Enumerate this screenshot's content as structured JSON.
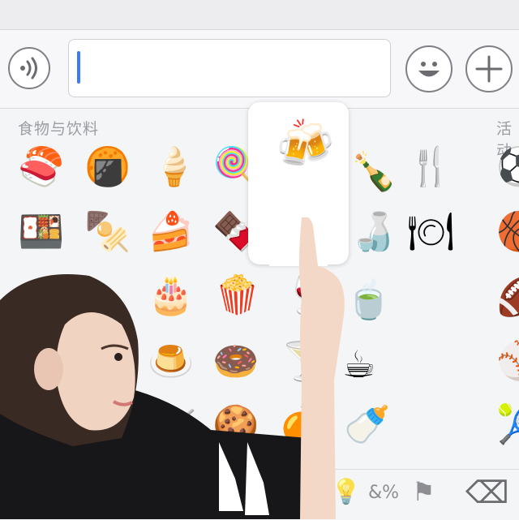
{
  "section_labels": {
    "food": "食物与饮料",
    "activity": "活动"
  },
  "popup_emoji": "🍻",
  "food_emojis": [
    "🍣",
    "🍘",
    "🍦",
    "🍭",
    "🍾",
    "🍴",
    "🍱",
    "🍢",
    "🍰",
    "🍫",
    "🍶",
    "🍽",
    "🎂",
    "🍿",
    "🍷",
    "🍵",
    "🍮",
    "🍩",
    "🍸",
    "☕",
    "🍧",
    "🍪",
    "🍊",
    "🍼"
  ],
  "activity_emojis": [
    "⚽",
    "🏀",
    "🏈",
    "⚾",
    "🎾"
  ],
  "toolbar_symbols": {
    "object": "💡",
    "symbols": "&%",
    "flag": "⚑",
    "delete": "⌫"
  }
}
